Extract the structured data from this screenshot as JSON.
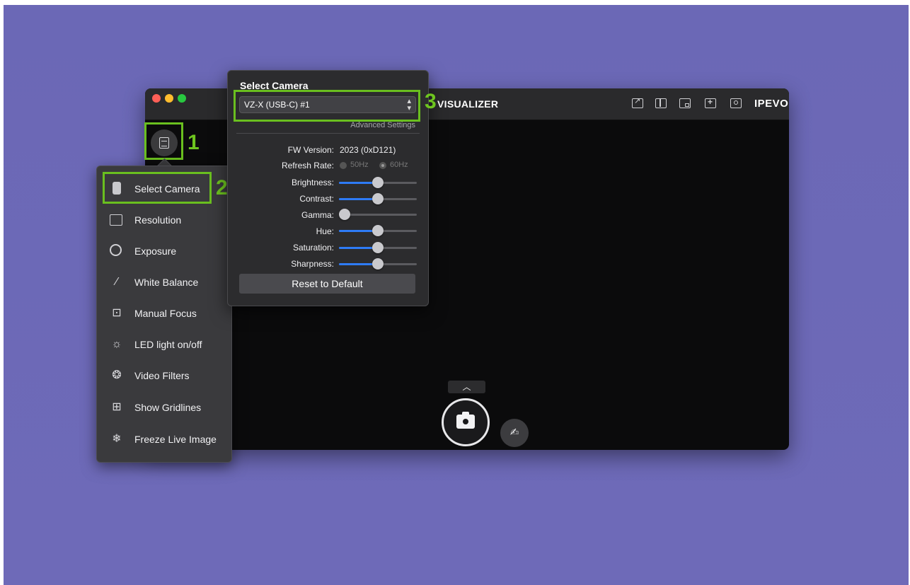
{
  "app": {
    "title": "VISUALIZER",
    "brand": "IPEVO"
  },
  "markers": [
    "1",
    "2",
    "3"
  ],
  "menu": {
    "items": [
      {
        "label": "Select Camera",
        "icon": "camera-device-icon"
      },
      {
        "label": "Resolution",
        "icon": "resolution-icon"
      },
      {
        "label": "Exposure",
        "icon": "exposure-icon"
      },
      {
        "label": "White Balance",
        "icon": "white-balance-icon"
      },
      {
        "label": "Manual Focus",
        "icon": "focus-icon"
      },
      {
        "label": "LED light on/off",
        "icon": "led-icon"
      },
      {
        "label": "Video Filters",
        "icon": "filters-icon"
      },
      {
        "label": "Show Gridlines",
        "icon": "grid-icon"
      },
      {
        "label": "Freeze Live Image",
        "icon": "snowflake-icon"
      }
    ]
  },
  "camera_panel": {
    "title": "Select Camera",
    "selected_camera": "VZ-X (USB-C) #1",
    "advanced_link": "Advanced Settings",
    "fw_label": "FW Version:",
    "fw_value": "2023 (0xD121)",
    "refresh_label": "Refresh Rate:",
    "refresh_options": [
      "50Hz",
      "60Hz"
    ],
    "refresh_selected": "60Hz",
    "sliders": [
      {
        "label": "Brightness:",
        "value": 0.5
      },
      {
        "label": "Contrast:",
        "value": 0.5
      },
      {
        "label": "Gamma:",
        "value": 0.0
      },
      {
        "label": "Hue:",
        "value": 0.5
      },
      {
        "label": "Saturation:",
        "value": 0.5
      },
      {
        "label": "Sharpness:",
        "value": 0.5
      }
    ],
    "reset_label": "Reset to Default"
  },
  "controls": {
    "expand_glyph": "︿",
    "annotate_glyph": "✍"
  },
  "colors": {
    "highlight": "#6abf1f",
    "slider_fill": "#2e7bf6",
    "background": "#6b68b6"
  }
}
